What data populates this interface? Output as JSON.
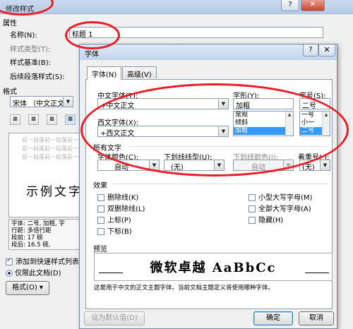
{
  "back_dialog": {
    "title": "修改样式",
    "title_buttons": {
      "help": "?",
      "close": "✕"
    },
    "section_properties": "属性",
    "name_label": "名称(N):",
    "name_value": "标题 1",
    "style_type_label": "样式类型(T):",
    "style_based_label": "样式基准(B):",
    "next_para_label": "后续段落样式(S):",
    "format_label": "格式",
    "font_value": "宋体 （中文正文",
    "preview_gray_text": [
      "前一段落前一段落前一段落前一段",
      "前一段落前一段落前一段落前一段",
      "前一段落前一段落前一段落前一段"
    ],
    "preview_sample": "示例文字",
    "description_lines": [
      "字体: 二号, 加粗, 字",
      "行距: 多倍行距",
      "段前: 17 磅",
      "段后: 16.5 磅,"
    ],
    "add_to_quick_label": "添加到快速样式列表",
    "only_this_doc_label": "仅限此文档(D)",
    "format_button": "格式(O) ▾"
  },
  "font_dialog": {
    "title": "字体",
    "title_buttons": {
      "help": "?",
      "close": "✕"
    },
    "tabs": [
      {
        "label": "字体(N)"
      },
      {
        "label": "高级(V)"
      }
    ],
    "cn_font_label": "中文字体(T):",
    "cn_font_value": "+中文正文",
    "west_font_label": "西文字体(X):",
    "west_font_value": "+西文正文",
    "style_label": "字形(Y):",
    "style_value": "加粗",
    "style_list": [
      "常规",
      "倾斜",
      "加粗"
    ],
    "style_selected_index": 2,
    "size_label": "字号(S):",
    "size_value": "二号",
    "size_list": [
      "一号",
      "小一",
      "二号"
    ],
    "size_selected_index": 2,
    "all_text_section": "所有文字",
    "font_color_label": "字体颜色(C):",
    "font_color_value": "自动",
    "underline_style_label": "下划线线型(U):",
    "underline_style_value": "(无)",
    "underline_color_label": "下划线颜色(I):",
    "underline_color_value": "自动",
    "emphasis_label": "着重号(·):",
    "emphasis_value": "(无)",
    "effects_section": "效果",
    "effects_left": [
      {
        "label": "删除线(K)",
        "checked": false
      },
      {
        "label": "双删除线(L)",
        "checked": false
      },
      {
        "label": "上标(P)",
        "checked": false
      },
      {
        "label": "下标(B)",
        "checked": false
      }
    ],
    "effects_right": [
      {
        "label": "小型大写字母(M)",
        "checked": false
      },
      {
        "label": "全部大写字母(A)",
        "checked": false
      },
      {
        "label": "隐藏(H)",
        "checked": false
      }
    ],
    "preview_section": "预览",
    "preview_text": "微软卓越 AaBbCc",
    "preview_note": "这是用于中文的正文主题字体。当前文档主题定义将使用哪种字体。",
    "set_default_button": "设为默认值(D)",
    "ok_button": "确定",
    "cancel_button": "取消"
  },
  "colors": {
    "annotation_red": "#ea1c24",
    "selection_blue": "#3399ff"
  }
}
